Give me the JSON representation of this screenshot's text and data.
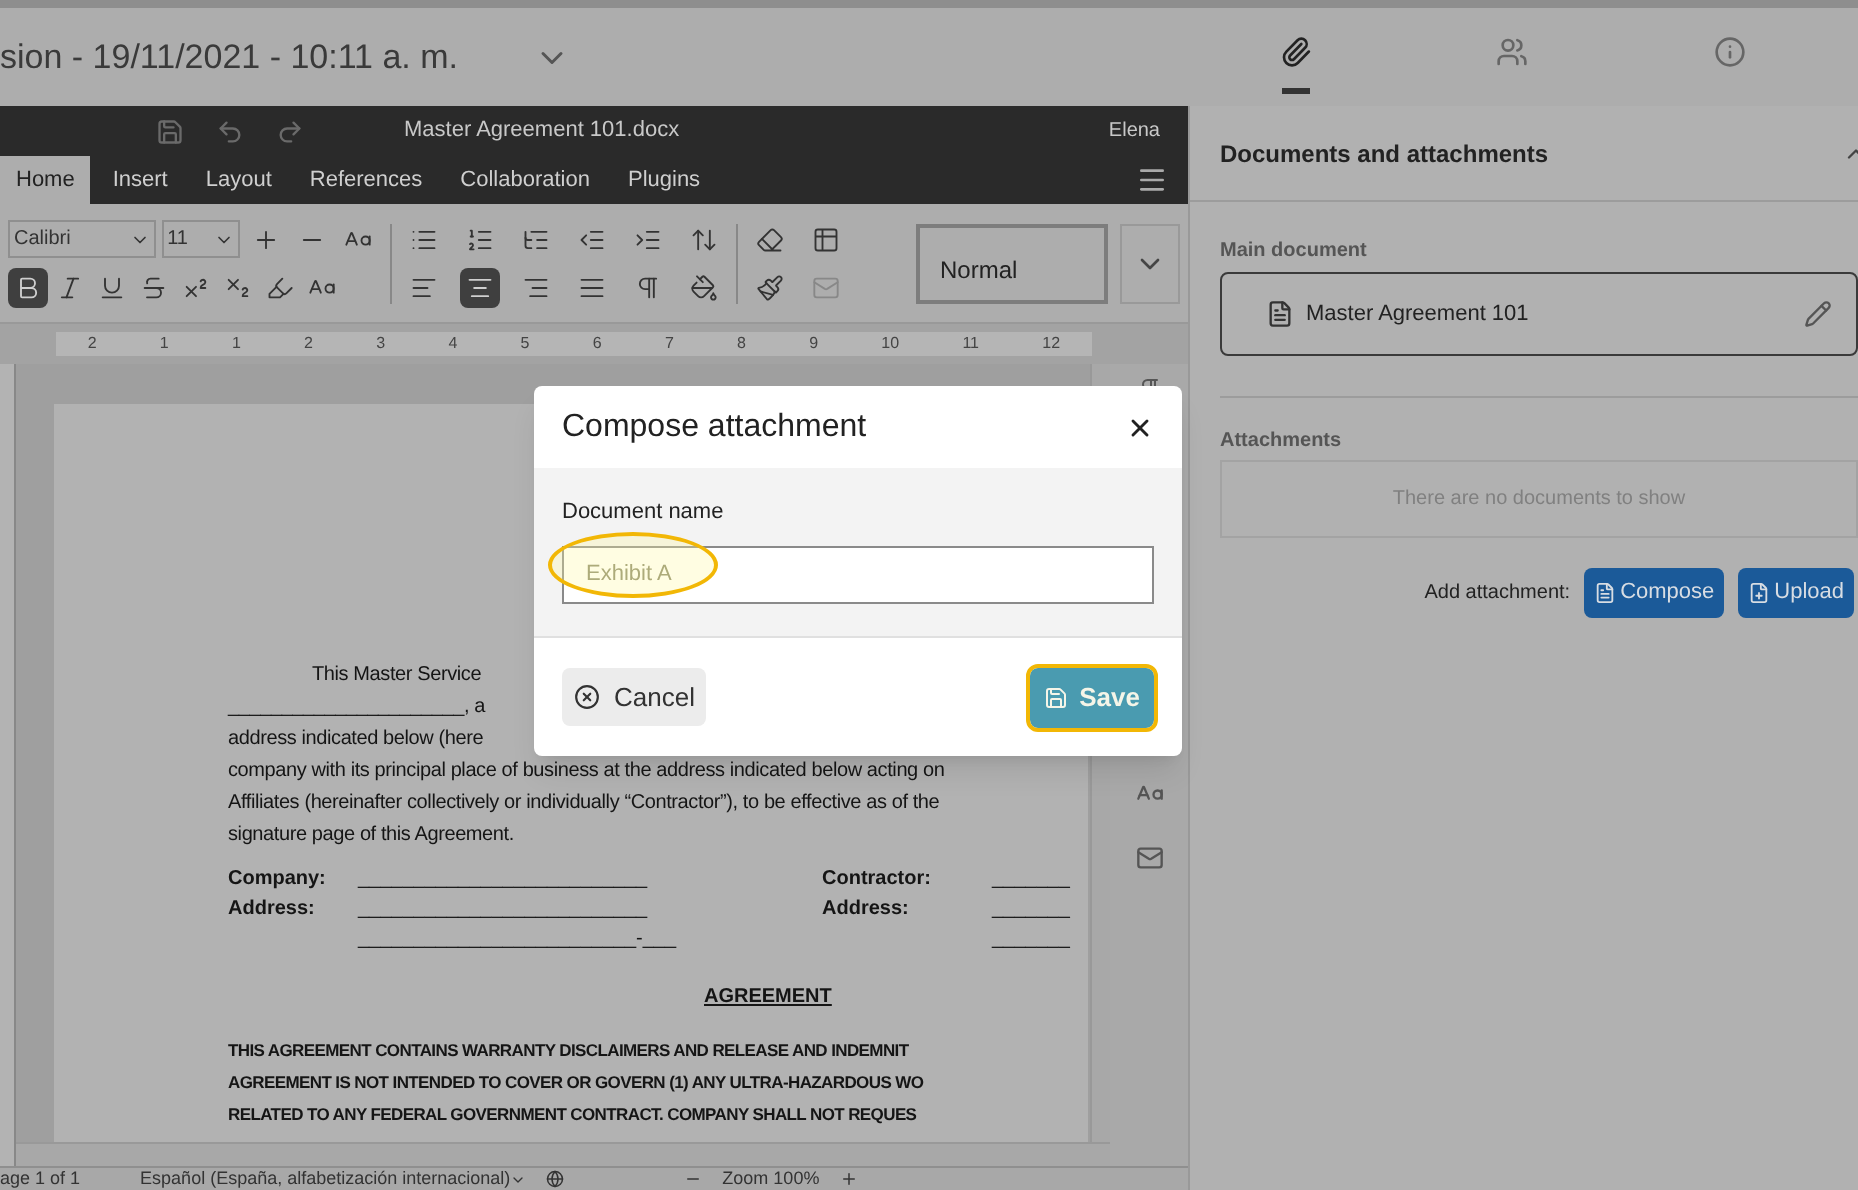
{
  "top_bar": {
    "version_label": "sion - 19/11/2021 - 10:11 a. m.",
    "panel_tabs": [
      {
        "selected": true
      },
      {
        "selected": false
      },
      {
        "selected": false
      }
    ]
  },
  "editor": {
    "title": "Master Agreement 101.docx",
    "user": "Elena",
    "tabs": [
      {
        "label": "Home",
        "selected": true
      },
      {
        "label": "Insert",
        "selected": false
      },
      {
        "label": "Layout",
        "selected": false
      },
      {
        "label": "References",
        "selected": false
      },
      {
        "label": "Collaboration",
        "selected": false
      },
      {
        "label": "Plugins",
        "selected": false
      }
    ],
    "font": "Calibri",
    "font_size": "11",
    "style": "Normal",
    "format_buttons": [
      {
        "selected": true
      },
      {
        "selected": false
      },
      {
        "selected": false
      },
      {
        "selected": false
      },
      {
        "selected": false
      },
      {
        "selected": false
      }
    ],
    "align_buttons": [
      {
        "selected": false
      },
      {
        "selected": true
      },
      {
        "selected": false
      },
      {
        "selected": false
      }
    ],
    "ruler_numbers": [
      "2",
      "1",
      "1",
      "2",
      "3",
      "4",
      "5",
      "6",
      "7",
      "8",
      "9",
      "10",
      "11",
      "12"
    ],
    "document": {
      "intro_first": "This   Master   Service",
      "intro_lines": [
        "______________________, a",
        "address  indicated  below  (here",
        "company with its principal place of business at the address indicated below acting on",
        "Affiliates (hereinafter collectively or individually “Contractor”), to be effective as of the",
        "signature page of this Agreement."
      ],
      "party_rows": [
        [
          "Company:",
          "__________________________",
          "Contractor:",
          "_______"
        ],
        [
          "Address:",
          "__________________________",
          "Address:",
          "_______"
        ],
        [
          "",
          "_________________________-___",
          "",
          "_______"
        ]
      ],
      "heading": "AGREEMENT",
      "bold_lines": [
        "THIS AGREEMENT CONTAINS WARRANTY DISCLAIMERS AND RELEASE AND INDEMNIT",
        "AGREEMENT IS NOT INTENDED TO COVER OR GOVERN (1) ANY ULTRA-HAZARDOUS WO",
        "RELATED TO ANY FEDERAL GOVERNMENT CONTRACT. COMPANY SHALL NOT REQUES"
      ]
    },
    "status_bar": {
      "page": "age 1 of 1",
      "language": "Español (España, alfabetización internacional)",
      "zoom": "Zoom 100%"
    }
  },
  "panel": {
    "title": "Documents and attachments",
    "main_label": "Main document",
    "main_document": "Master Agreement 101",
    "attachments_label": "Attachments",
    "empty_text": "There are no documents to show",
    "add_label": "Add attachment:",
    "buttons": [
      "Compose",
      "Upload"
    ]
  },
  "dialog": {
    "title": "Compose attachment",
    "field_label": "Document name",
    "placeholder": "Exhibit A",
    "cancel": "Cancel",
    "save": "Save"
  }
}
